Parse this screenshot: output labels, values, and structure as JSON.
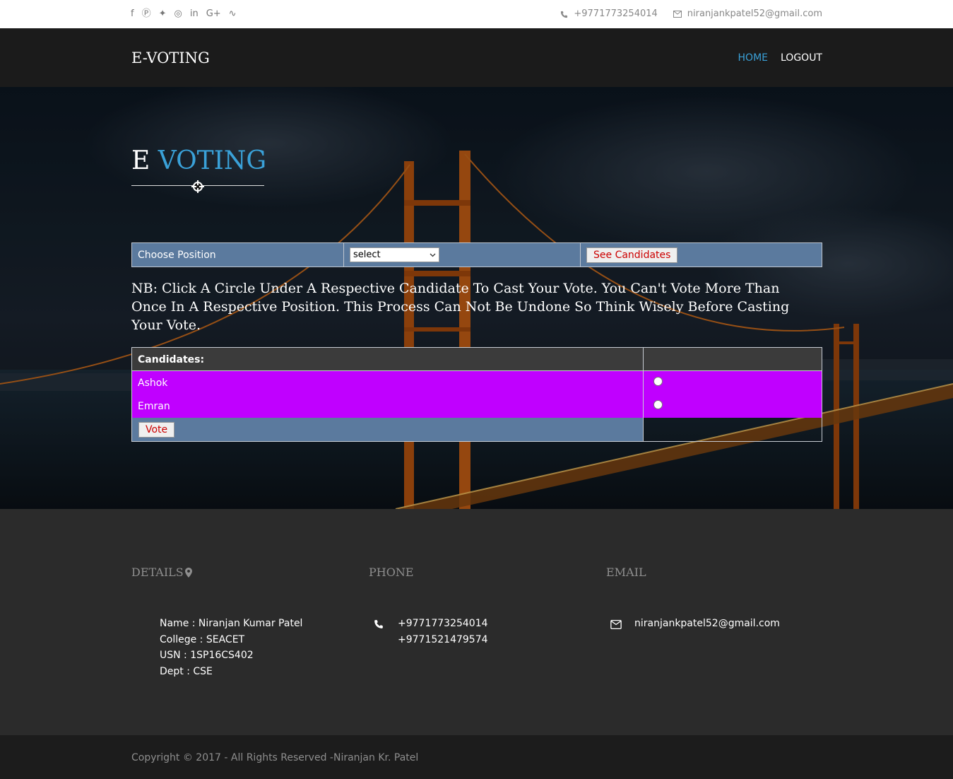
{
  "topbar": {
    "social_icons": [
      "facebook-icon",
      "pinterest-icon",
      "twitter-icon",
      "dribbble-icon",
      "linkedin-icon",
      "google-plus-icon",
      "rss-icon"
    ],
    "phone": "+9771773254014",
    "email": "niranjankpatel52@gmail.com"
  },
  "header": {
    "brand": "E-VOTING",
    "nav": [
      {
        "label": "HOME",
        "active": true
      },
      {
        "label": "LOGOUT",
        "active": false
      }
    ]
  },
  "hero": {
    "title_part1": "E",
    "title_part2": "VOTING",
    "position_label": "Choose Position",
    "select_value": "select",
    "see_candidates_label": "See Candidates",
    "note": "NB: Click A Circle Under A Respective Candidate To Cast Your Vote. You Can't Vote More Than Once In A Respective Position. This Process Can Not Be Undone So Think Wisely Before Casting Your Vote.",
    "candidates_header": "Candidates:",
    "candidates": [
      "Ashok",
      "Emran"
    ],
    "vote_label": "Vote"
  },
  "footer": {
    "details_title": "DETAILS",
    "phone_title": "PHONE",
    "email_title": "EMAIL",
    "details": [
      "Name : Niranjan Kumar Patel",
      "College : SEACET",
      "USN : 1SP16CS402",
      "Dept : CSE"
    ],
    "phones": [
      "+9771773254014",
      "+9771521479574"
    ],
    "email": "niranjankpatel52@gmail.com",
    "copyright": "Copyright © 2017 - All Rights Reserved -Niranjan Kr. Patel"
  },
  "colors": {
    "accent": "#3aa1d8",
    "candidate_row": "#c000ff",
    "table_blue": "#5b7a9e",
    "button_text": "#cc0000"
  }
}
